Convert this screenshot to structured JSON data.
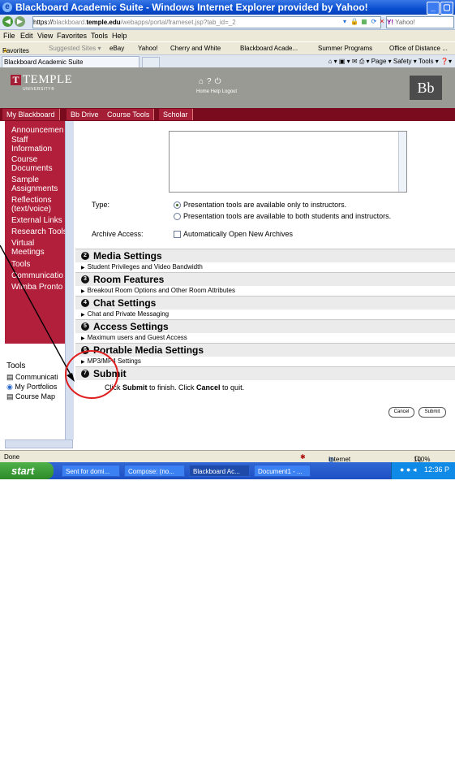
{
  "window": {
    "title": "Blackboard Academic Suite - Windows Internet Explorer provided by Yahoo!"
  },
  "address": {
    "url_scheme": "https://",
    "url_sub": "blackboard.",
    "url_host": "temple.edu",
    "url_path": "/webapps/portal/frameset.jsp?tab_id=_2",
    "search_placeholder": "Yahoo!"
  },
  "menu": [
    "File",
    "Edit",
    "View",
    "Favorites",
    "Tools",
    "Help"
  ],
  "favorites": {
    "label": "Favorites",
    "items": [
      "Suggested Sites ▾",
      "eBay",
      "Yahoo!",
      "Cherry and White",
      "Blackboard Acade...",
      "Summer Programs",
      "Office of Distance ..."
    ]
  },
  "tab": {
    "label": "Blackboard Academic Suite"
  },
  "command_bar": "Page ▾  Safety ▾  Tools ▾",
  "header": {
    "logo_word": "TEMPLE",
    "logo_sub": "UNIVERSITY®",
    "links": "Home  Help  Logout",
    "bb_logo": "Bb"
  },
  "nav_tabs": [
    "My Blackboard",
    "Bb Drive",
    "Course Tools",
    "Scholar"
  ],
  "sidebar": {
    "items": [
      "Announcemen",
      "Staff",
      "Information",
      "Course",
      "Documents",
      "Sample",
      "Assignments",
      "Reflections",
      "(text/voice)",
      "External Links",
      "Research Tools",
      "Virtual",
      "Meetings",
      "Tools",
      "Communicatio",
      "Wimba Pronto"
    ],
    "tools_heading": "Tools",
    "tools_items": [
      "Communicati",
      "My Portfolios",
      "Course Map"
    ]
  },
  "form": {
    "type_label": "Type:",
    "type_option_1": "Presentation tools are available only to instructors.",
    "type_option_2": "Presentation tools are available to both students and instructors.",
    "archive_label": "Archive Access:",
    "archive_option": "Automatically Open New Archives"
  },
  "sections": [
    {
      "num": "2",
      "title": "Media Settings",
      "sub": "Student Privileges and Video Bandwidth"
    },
    {
      "num": "3",
      "title": "Room Features",
      "sub": "Breakout Room Options and Other Room Attributes"
    },
    {
      "num": "4",
      "title": "Chat Settings",
      "sub": "Chat and Private Messaging"
    },
    {
      "num": "5",
      "title": "Access Settings",
      "sub": "Maximum users and Guest Access"
    },
    {
      "num": "6",
      "title": "Portable Media Settings",
      "sub": "MP3/MP4 Settings"
    },
    {
      "num": "7",
      "title": "Submit",
      "sub": ""
    }
  ],
  "submit_text": {
    "pre": "Click ",
    "submit_word": "Submit",
    "mid": " to finish.  Click ",
    "cancel_word": "Cancel",
    "post": " to quit."
  },
  "buttons": {
    "cancel": "Cancel",
    "submit": "Submit"
  },
  "status": {
    "left": "Done",
    "zone": "Internet",
    "zoom": "100%"
  },
  "taskbar": {
    "start": "start",
    "tasks": [
      "Sent for domi...",
      "Compose: (no...",
      "Blackboard Ac...",
      "Document1 - ..."
    ],
    "clock": "12:36 P"
  },
  "annotation": {
    "circle_color": "#e02020",
    "arrow_color": "#000000"
  }
}
